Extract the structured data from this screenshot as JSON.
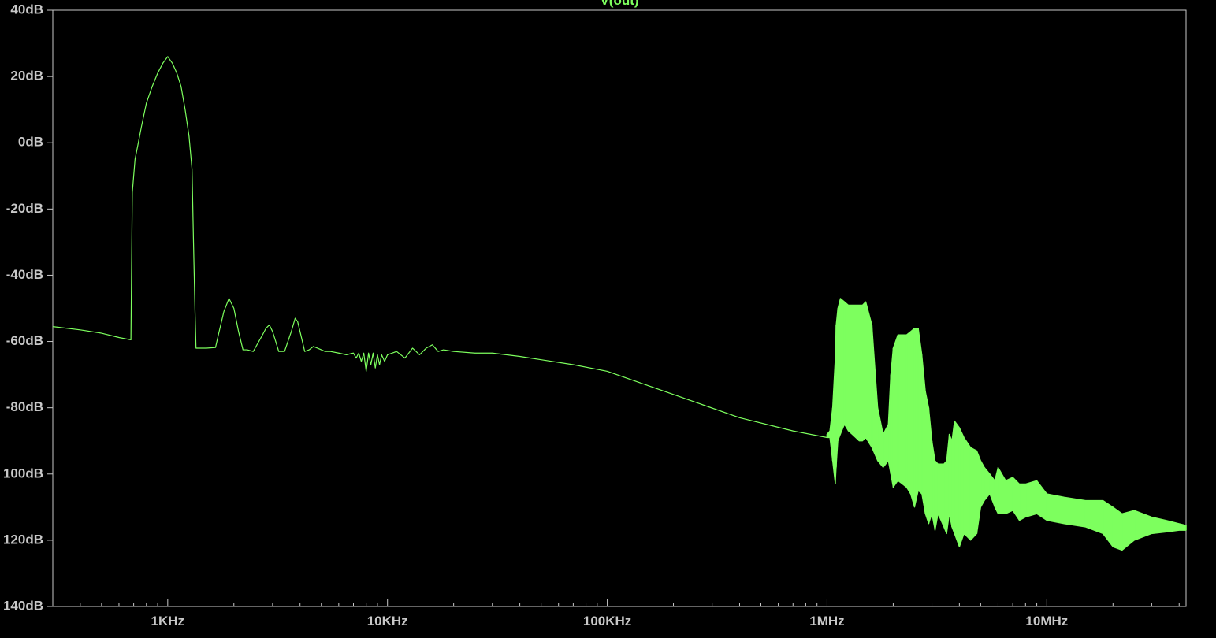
{
  "chart_data": {
    "type": "line",
    "title": "V(out)",
    "xlabel": "",
    "ylabel": "",
    "x_scale": "log",
    "xlim": [
      300,
      43000000
    ],
    "ylim": [
      -140,
      40
    ],
    "grid": false,
    "legend": "none",
    "colors": {
      "background": "#000000",
      "axes": "#c8c8c8",
      "trace": "#7dff5e"
    },
    "y_ticks": [
      {
        "value": 40,
        "label": "40dB"
      },
      {
        "value": 20,
        "label": "20dB"
      },
      {
        "value": 0,
        "label": "0dB"
      },
      {
        "value": -20,
        "label": "-20dB"
      },
      {
        "value": -40,
        "label": "-40dB"
      },
      {
        "value": -60,
        "label": "-60dB"
      },
      {
        "value": -80,
        "label": "-80dB"
      },
      {
        "value": -100,
        "label": "100dB"
      },
      {
        "value": -120,
        "label": "120dB"
      },
      {
        "value": -140,
        "label": "140dB"
      }
    ],
    "x_ticks": [
      {
        "value": 1000,
        "label": "1KHz"
      },
      {
        "value": 10000,
        "label": "10KHz"
      },
      {
        "value": 100000,
        "label": "100KHz"
      },
      {
        "value": 1000000,
        "label": "1MHz"
      },
      {
        "value": 10000000,
        "label": "10MHz"
      }
    ],
    "series": [
      {
        "x": [
          300,
          400,
          500,
          600,
          680,
          690,
          710,
          730,
          760,
          800,
          850,
          900,
          950,
          1000,
          1050,
          1100,
          1150,
          1200,
          1250,
          1290,
          1310,
          1330,
          1345,
          1360,
          1500,
          1650,
          1700,
          1800,
          1900,
          2000,
          2100,
          2200,
          2300,
          2450,
          2700,
          2800,
          2900,
          3000,
          3100,
          3200,
          3400,
          3650,
          3800,
          3900,
          4000,
          4100,
          4200,
          4400,
          4600,
          4800,
          5000,
          5200,
          5500,
          6000,
          6500,
          7000,
          7200,
          7400,
          7600,
          7800,
          8000,
          8200,
          8400,
          8600,
          8800,
          9000,
          9200,
          9400,
          9700,
          10000,
          11000,
          12000,
          13000,
          14000,
          15000,
          16000,
          17000,
          18000,
          20000,
          25000,
          30000,
          40000,
          50000,
          70000,
          100000,
          200000,
          400000,
          700000,
          1000000
        ],
        "y": [
          -55.5,
          -56.5,
          -57.5,
          -58.8,
          -59.5,
          -15,
          -5,
          -1,
          5,
          12,
          17,
          21,
          24,
          26,
          24,
          21,
          17,
          10,
          2,
          -8,
          -30,
          -50,
          -62,
          -62,
          -62,
          -61.8,
          -58,
          -51,
          -47,
          -50,
          -57,
          -62.5,
          -62.5,
          -63,
          -58,
          -56,
          -55,
          -57,
          -60,
          -63,
          -63,
          -57,
          -53,
          -54,
          -57,
          -60,
          -63,
          -62.5,
          -61.5,
          -62,
          -62.5,
          -63,
          -63,
          -63.5,
          -64,
          -63.5,
          -65,
          -63.5,
          -66,
          -63.5,
          -69,
          -63.5,
          -67,
          -63.5,
          -68,
          -64,
          -67,
          -64,
          -66,
          -64,
          -63,
          -65,
          -62,
          -64,
          -62,
          -61,
          -63,
          -62.5,
          -63,
          -63.5,
          -63.5,
          -64.5,
          -65.5,
          -67,
          -69,
          -76,
          -83,
          -87,
          -89
        ]
      },
      {
        "fill": true,
        "x": [
          1000000,
          1030000,
          1060000,
          1090000,
          1100000,
          1120000,
          1150000,
          1200000,
          1250000,
          1300000,
          1350000,
          1400000,
          1450000,
          1500000,
          1600000,
          1700000,
          1800000,
          1900000,
          1950000,
          2000000,
          2100000,
          2200000,
          2300000,
          2400000,
          2500000,
          2600000,
          2700000,
          2800000,
          2900000,
          3000000,
          3100000,
          3200000,
          3400000,
          3500000,
          3600000,
          3700000,
          3800000,
          4000000,
          4200000,
          4500000,
          4800000,
          5000000,
          5200000,
          5500000,
          5800000,
          6000000,
          6500000,
          7000000,
          7500000,
          8000000,
          9000000,
          10000000,
          12000000,
          15000000,
          18000000,
          20000000,
          22000000,
          25000000,
          30000000,
          35000000,
          40000000,
          43000000
        ],
        "y_top": [
          -88,
          -87,
          -80,
          -65,
          -55,
          -50,
          -47,
          -48,
          -49,
          -49,
          -49,
          -49,
          -49,
          -48,
          -55,
          -80,
          -88,
          -85,
          -70,
          -62,
          -58,
          -58,
          -58,
          -57,
          -56,
          -56,
          -64,
          -75,
          -80,
          -90,
          -96,
          -97,
          -97,
          -96,
          -88,
          -90,
          -84,
          -86,
          -89,
          -92,
          -93,
          -96,
          -98,
          -100,
          -102,
          -98,
          -102,
          -101,
          -103,
          -103,
          -102,
          -106,
          -107,
          -108,
          -108,
          -110,
          -112,
          -111,
          -113,
          -114,
          -115,
          -115.5
        ],
        "y_bottom": [
          -89,
          -89,
          -96,
          -103,
          -98,
          -90,
          -88,
          -85,
          -87,
          -88,
          -89,
          -90,
          -90,
          -89,
          -92,
          -96,
          -98,
          -96,
          -100,
          -104,
          -102,
          -103,
          -104,
          -106,
          -110,
          -105,
          -106,
          -112,
          -115,
          -112,
          -117,
          -112,
          -116,
          -118,
          -112,
          -116,
          -118,
          -122,
          -118,
          -120,
          -118,
          -110,
          -108,
          -106,
          -110,
          -112,
          -112,
          -111,
          -114,
          -113,
          -112,
          -114,
          -115,
          -116,
          -118,
          -122,
          -123,
          -120,
          -118,
          -117.5,
          -117,
          -117
        ]
      }
    ]
  }
}
